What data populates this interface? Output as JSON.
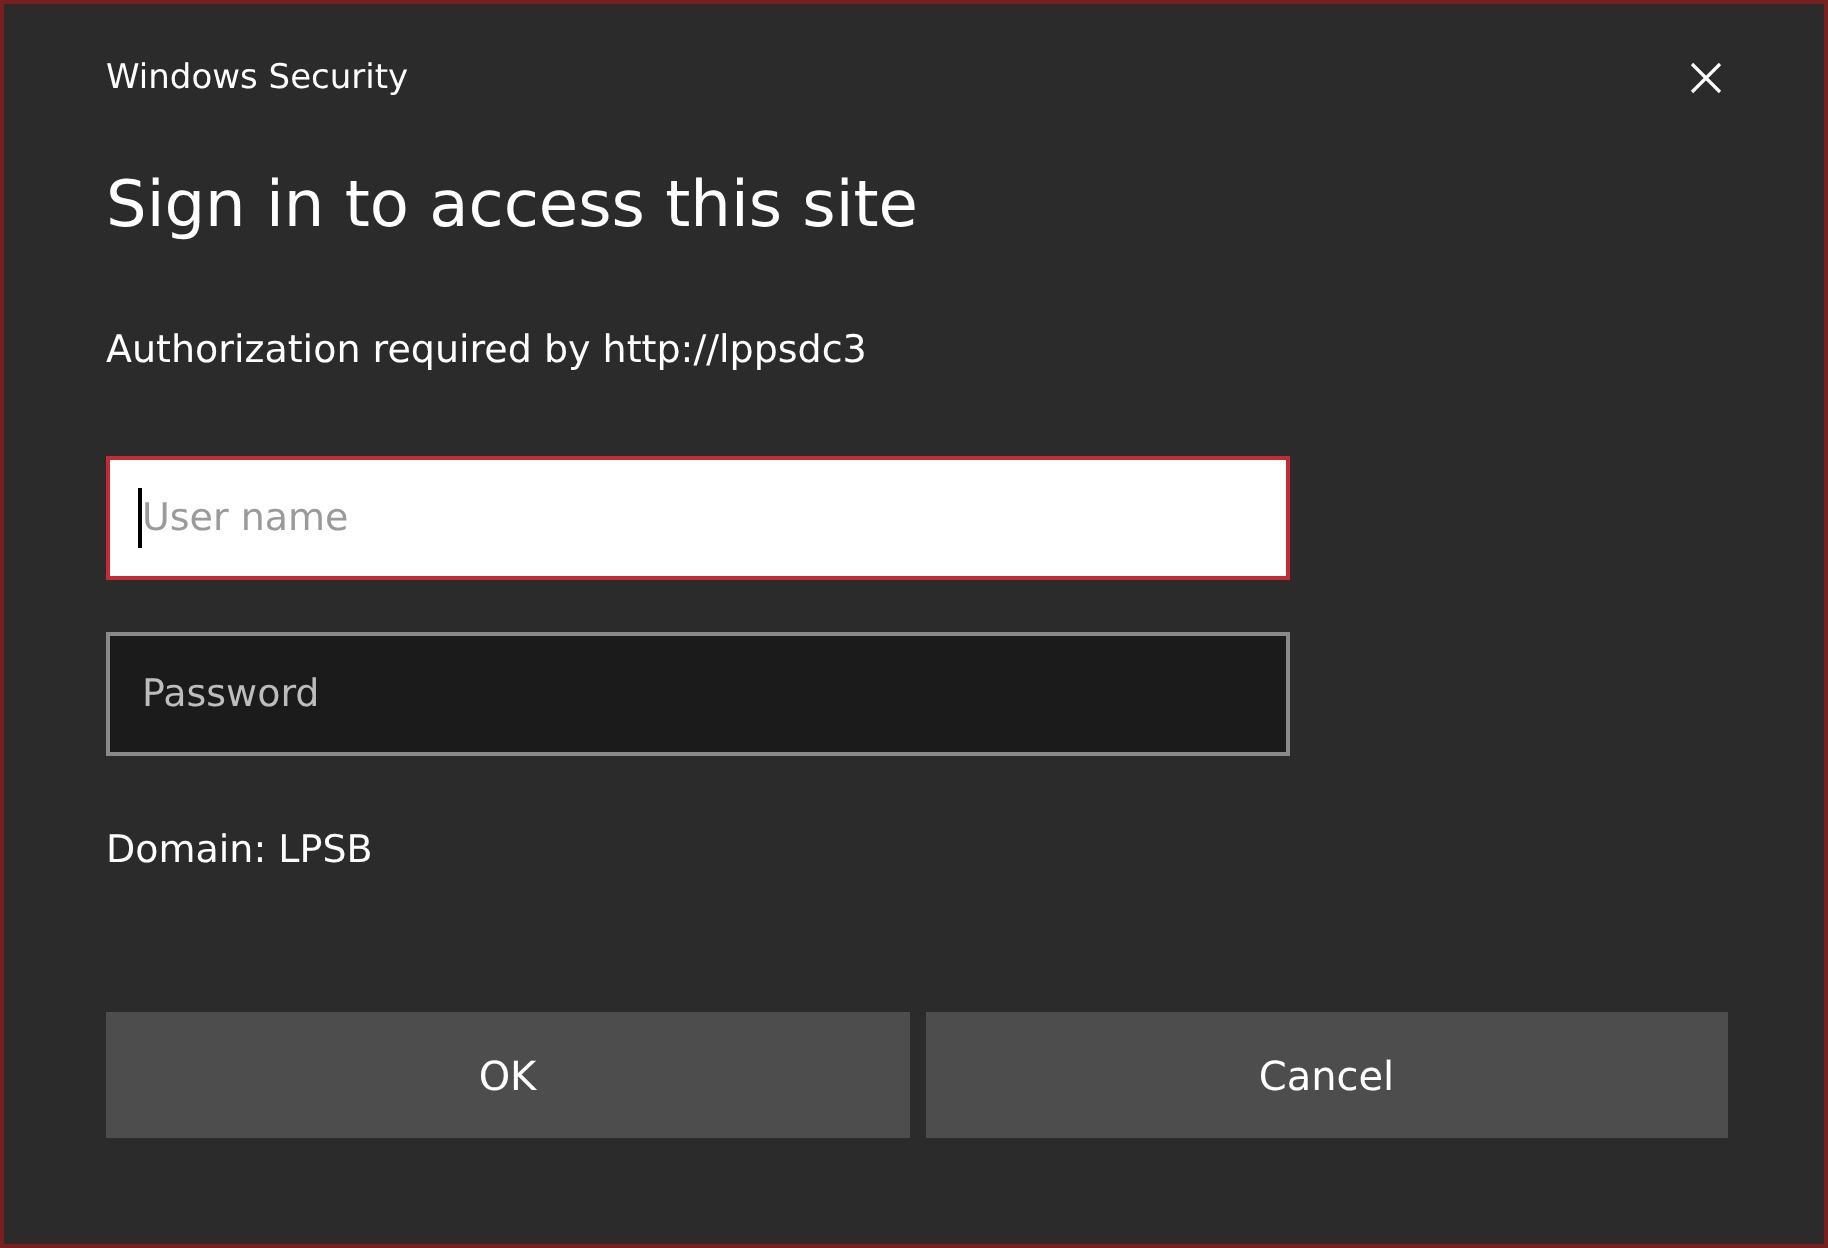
{
  "window": {
    "title": "Windows Security"
  },
  "heading": "Sign in to access this site",
  "message": "Authorization required by http://lppsdc3",
  "fields": [
    {
      "placeholder": "User name",
      "focused": true
    },
    {
      "placeholder": "Password",
      "focused": false
    }
  ],
  "domain": "Domain: LPSB",
  "buttons": [
    "OK",
    "Cancel"
  ]
}
